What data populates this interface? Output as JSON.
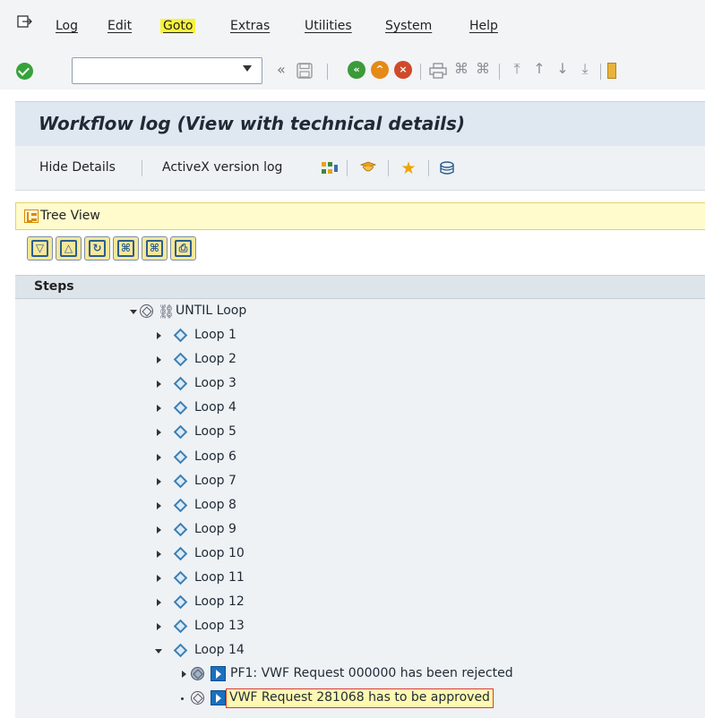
{
  "menubar": {
    "items": [
      "Log",
      "Edit",
      "Goto",
      "Extras",
      "Utilities",
      "System",
      "Help"
    ],
    "active": "Goto",
    "highlight_color": "#f7f33a"
  },
  "toolbar": {
    "command_field_value": "",
    "icons": [
      "enter-icon",
      "back-arrows-icon",
      "save-icon",
      "back-icon",
      "exit-icon",
      "cancel-icon",
      "print-icon",
      "find-icon",
      "find-next-icon",
      "first-page-icon",
      "previous-page-icon",
      "next-page-icon",
      "last-page-icon"
    ]
  },
  "title": "Workflow log (View with technical details)",
  "app_toolbar": {
    "hide_details": "Hide Details",
    "activex_log": "ActiveX version log",
    "icons": [
      "graphic-icon",
      "agent-icon",
      "favorite-icon",
      "database-icon"
    ]
  },
  "tree_view": {
    "label": "Tree View",
    "tools": [
      "expand-all-icon",
      "collapse-all-icon",
      "refresh-icon",
      "find-icon",
      "find-next-icon",
      "print-icon"
    ]
  },
  "tree": {
    "column_header": "Steps",
    "root": "UNTIL Loop",
    "loops": [
      "Loop 1",
      "Loop 2",
      "Loop 3",
      "Loop 4",
      "Loop 5",
      "Loop 6",
      "Loop 7",
      "Loop 8",
      "Loop 9",
      "Loop 10",
      "Loop 11",
      "Loop 12",
      "Loop 13",
      "Loop 14"
    ],
    "children": [
      "PF1: VWF Request 000000 has been rejected",
      "VWF Request 281068 has to be approved"
    ]
  },
  "colors": {
    "accent_blue": "#1a6fbf",
    "selection_border": "#e03a2a",
    "tree_background": "#eef2f5"
  }
}
